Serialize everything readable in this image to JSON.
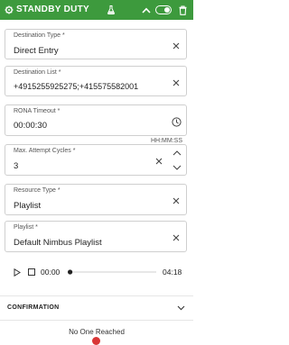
{
  "header": {
    "title": "STANDBY DUTY",
    "icons": [
      "settings-icon",
      "flask-icon",
      "chevron-up-icon",
      "toggle",
      "trash-icon"
    ]
  },
  "fields": {
    "destination_type": {
      "label": "Destination Type *",
      "value": "Direct Entry"
    },
    "destination_list": {
      "label": "Destination List *",
      "value": "+4915255925275;+415575582001"
    },
    "rona_timeout": {
      "label": "RONA Timeout *",
      "value": "00:00:30",
      "hint": "HH:MM:SS"
    },
    "max_attempt_cycles": {
      "label": "Max. Attempt Cycles *",
      "value": "3"
    },
    "resource_type": {
      "label": "Resource Type *",
      "value": "Playlist"
    },
    "playlist": {
      "label": "Playlist *",
      "value": "Default Nimbus Playlist"
    }
  },
  "player": {
    "current_time": "00:00",
    "duration": "04:18",
    "progress": 0
  },
  "confirmation": {
    "title": "CONFIRMATION",
    "status": "No One Reached"
  },
  "colors": {
    "header_bg": "#3d9a3d",
    "header_text": "#ffffff",
    "alert_dot": "#d93636"
  }
}
